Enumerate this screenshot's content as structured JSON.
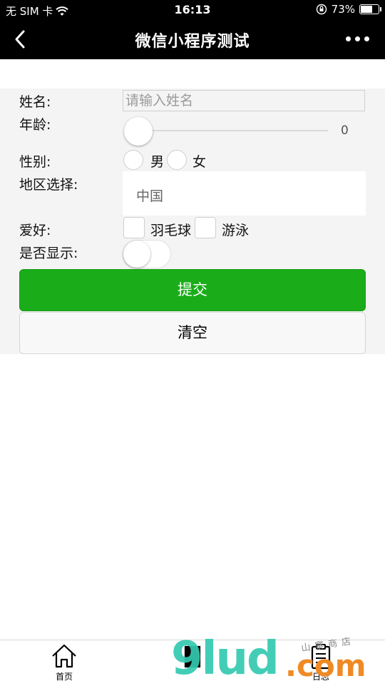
{
  "status_bar": {
    "carrier": "无 SIM 卡",
    "time": "16:13",
    "battery": "73%",
    "battery_level": 0.73,
    "icons": [
      "wifi-icon",
      "orientation-lock-icon",
      "battery-icon"
    ]
  },
  "nav": {
    "title": "微信小程序测试",
    "back_icon": "chevron-left-icon",
    "more_icon": "more-dots-icon"
  },
  "form": {
    "name_label": "姓名:",
    "name_placeholder": "请输入姓名",
    "age_label": "年龄:",
    "age_value": "0",
    "gender_label": "性别:",
    "gender_options": [
      "男",
      "女"
    ],
    "region_label": "地区选择:",
    "region_value": "中国",
    "hobby_label": "爱好:",
    "hobby_options": [
      "羽毛球",
      "游泳"
    ],
    "show_label": "是否显示:",
    "show_switch_on": false,
    "submit_label": "提交",
    "clear_label": "清空"
  },
  "tabbar": {
    "items": [
      {
        "label": "首页",
        "icon": "home-icon"
      },
      {
        "label": "",
        "icon": "document-icon"
      },
      {
        "label": "日志",
        "icon": "clipboard-icon"
      }
    ]
  },
  "watermark": {
    "main": "9lud",
    "suffix": ".com",
    "small": "山寨商店"
  },
  "colors": {
    "primary": "#1aad19",
    "navbar": "#000000",
    "form_bg": "#f4f4f4"
  }
}
